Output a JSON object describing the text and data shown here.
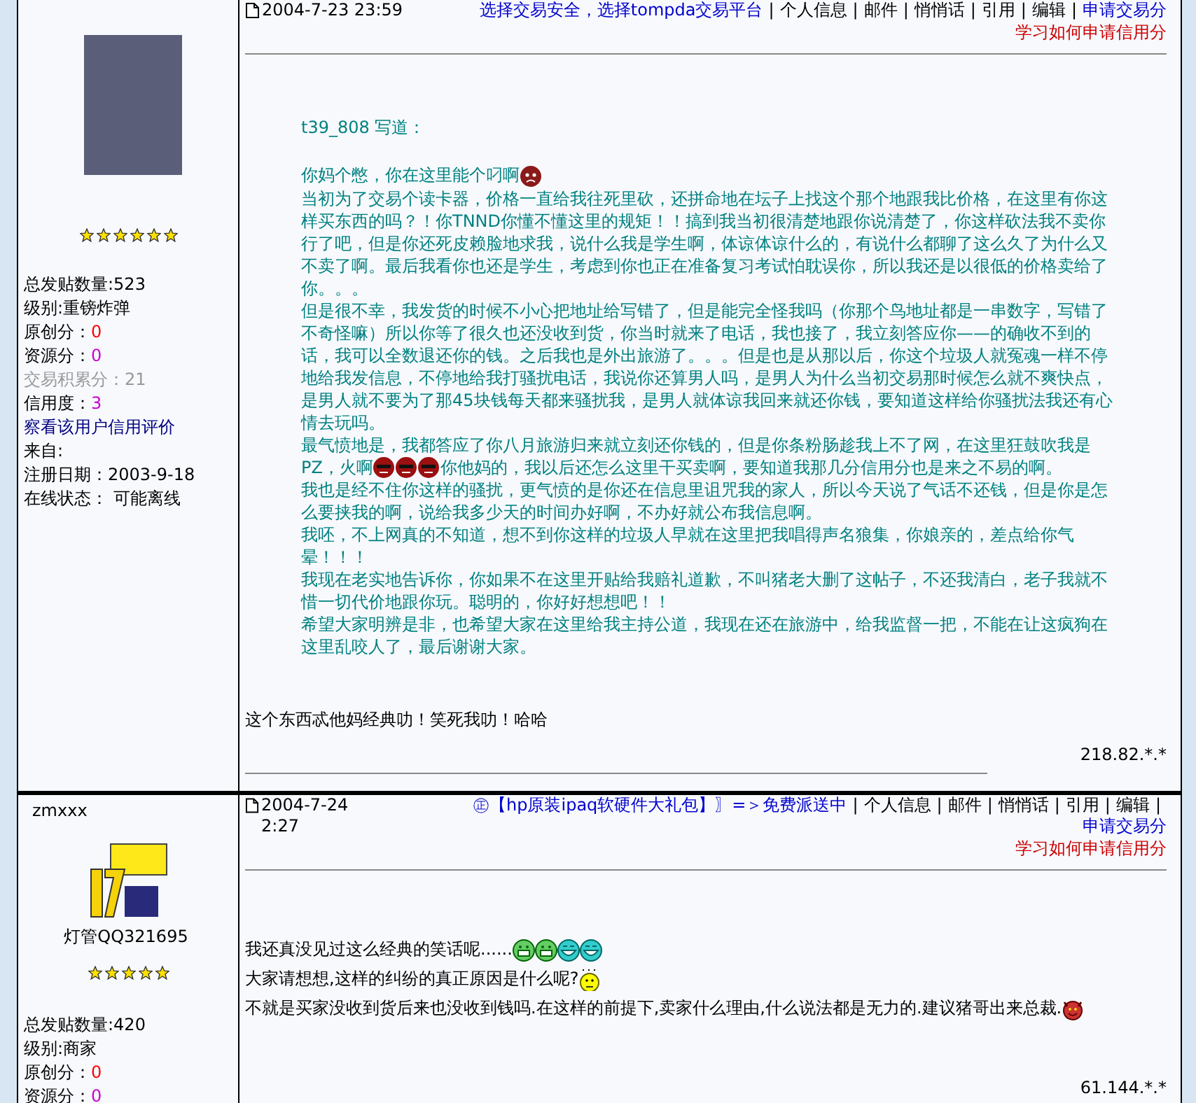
{
  "posts": [
    {
      "author": {
        "avatar": {
          "kind": "photo"
        },
        "stars": 6,
        "stats": [
          {
            "kind": "text",
            "label": "总发贴数量:523"
          },
          {
            "kind": "text",
            "label": "级别:重镑炸弹"
          },
          {
            "kind": "value",
            "label": "原创分：",
            "value": "0",
            "color": "#ff0000"
          },
          {
            "kind": "value",
            "label": "资源分：",
            "value": "0",
            "color": "#cc00cc"
          },
          {
            "kind": "dim",
            "label": "交易积累分：21"
          },
          {
            "kind": "value",
            "label": "信用度：",
            "value": "3",
            "color": "#cc00cc"
          },
          {
            "kind": "link",
            "label": "察看该用户信用评价"
          },
          {
            "kind": "text",
            "label": "来自:"
          },
          {
            "kind": "text",
            "label": "注册日期：2003-9-18"
          },
          {
            "kind": "text",
            "label": "在线状态： 可能离线"
          }
        ]
      },
      "date": "2004-7-23 23:59",
      "links": [
        {
          "kind": "promo",
          "text": "选择交易安全，选择tompda交易平台"
        },
        {
          "kind": "separator",
          "text": "|"
        },
        {
          "kind": "action",
          "text": "个人信息"
        },
        {
          "kind": "separator",
          "text": "|"
        },
        {
          "kind": "action",
          "text": "邮件"
        },
        {
          "kind": "separator",
          "text": "|"
        },
        {
          "kind": "action",
          "text": "悄悄话"
        },
        {
          "kind": "separator",
          "text": "|"
        },
        {
          "kind": "action",
          "text": "引用"
        },
        {
          "kind": "separator",
          "text": "|"
        },
        {
          "kind": "action",
          "text": "编辑"
        },
        {
          "kind": "separator",
          "text": "|"
        },
        {
          "kind": "apply",
          "text": "申请交易分"
        }
      ],
      "credit_link": "学习如何申请信用分",
      "quote": {
        "header": "t39_808 写道：",
        "paragraphs": [
          [
            {
              "kind": "text",
              "text": "你妈个憋，你在这里能个叼啊"
            },
            {
              "kind": "sad-face"
            }
          ],
          [
            {
              "kind": "text",
              "text": "当初为了交易个读卡器，价格一直给我往死里砍，还拼命地在坛子上找这个那个地跟我比价格，在这里有你这样买东西的吗？！你TNND你懂不懂这里的规矩！！搞到我当初很清楚地跟你说清楚了，你这样砍法我不卖你行了吧，但是你还死皮赖脸地求我，说什么我是学生啊，体谅体谅什么的，有说什么都聊了这么久了为什么又不卖了啊。最后我看你也还是学生，考虑到你也正在准备复习考试怕耽误你，所以我还是以很低的价格卖给了你。。。"
            }
          ],
          [
            {
              "kind": "text",
              "text": "但是很不幸，我发货的时候不小心把地址给写错了，但是能完全怪我吗（你那个鸟地址都是一串数字，写错了不奇怪嘛）所以你等了很久也还没收到货，你当时就来了电话，我也接了，我立刻答应你——的确收不到的话，我可以全数退还你的钱。之后我也是外出旅游了。。。但是也是从那以后，你这个垃圾人就冤魂一样不停地给我发信息，不停地给我打骚扰电话，我说你还算男人吗，是男人为什么当初交易那时候怎么就不爽快点，是男人就不要为了那45块钱每天都来骚扰我，是男人就体谅我回来就还你钱，要知道这样给你骚扰法我还有心情去玩吗。"
            }
          ],
          [
            {
              "kind": "text",
              "text": "最气愤地是，我都答应了你八月旅游归来就立刻还你钱的，但是你条粉肠趁我上不了网，在这里狂鼓吹我是"
            }
          ],
          [
            {
              "kind": "text",
              "text": "PZ，火啊"
            },
            {
              "kind": "sunglasses-face"
            },
            {
              "kind": "sunglasses-face"
            },
            {
              "kind": "sunglasses-face"
            },
            {
              "kind": "text",
              "text": "你他妈的，我以后还怎么这里干买卖啊，要知道我那几分信用分也是来之不易的啊。"
            }
          ],
          [
            {
              "kind": "text",
              "text": "我也是经不住你这样的骚扰，更气愤的是你还在信息里诅咒我的家人，所以今天说了气话不还钱，但是你是怎么要挟我的啊，说给我多少天的时间办好啊，不办好就公布我信息啊。"
            }
          ],
          [
            {
              "kind": "text",
              "text": "我呸，不上网真的不知道，想不到你这样的垃圾人早就在这里把我唱得声名狼集，你娘亲的，差点给你气晕！！！"
            }
          ],
          [
            {
              "kind": "text",
              "text": "我现在老实地告诉你，你如果不在这里开贴给我赔礼道歉，不叫猪老大删了这帖子，不还我清白，老子我就不惜一切代价地跟你玩。聪明的，你好好想想吧！！"
            }
          ],
          [
            {
              "kind": "text",
              "text": "希望大家明辨是非，也希望大家在这里给我主持公道，我现在还在旅游中，给我监督一把，不能在让这疯狗在这里乱咬人了，最后谢谢大家。"
            }
          ]
        ]
      },
      "reply": [
        [
          {
            "kind": "text",
            "text": "这个东西忒他妈经典叻！笑死我叻！哈哈"
          }
        ]
      ],
      "ip": "218.82.*.*",
      "signature_divider": true
    },
    {
      "author": {
        "name": "zmxxx",
        "avatar": {
          "kind": "logo"
        },
        "nickname": "灯管QQ321695",
        "stars": 5,
        "stats": [
          {
            "kind": "text",
            "label": "总发贴数量:420"
          },
          {
            "kind": "text",
            "label": "级别:商家"
          },
          {
            "kind": "value",
            "label": "原创分：",
            "value": "0",
            "color": "#ff0000"
          },
          {
            "kind": "value",
            "label": "资源分：",
            "value": "0",
            "color": "#cc00cc"
          }
        ]
      },
      "date": "2004-7-24 2:27",
      "links": [
        {
          "kind": "promo",
          "text": "㊣【hp原装ipaq软硬件大礼包】〗=＞免费派送中"
        },
        {
          "kind": "separator",
          "text": "|"
        },
        {
          "kind": "action",
          "text": "个人信息"
        },
        {
          "kind": "separator",
          "text": "|"
        },
        {
          "kind": "action",
          "text": "邮件"
        },
        {
          "kind": "separator",
          "text": "|"
        },
        {
          "kind": "action",
          "text": "悄悄话"
        },
        {
          "kind": "separator",
          "text": "|"
        },
        {
          "kind": "action",
          "text": "引用"
        },
        {
          "kind": "separator",
          "text": "|"
        },
        {
          "kind": "action",
          "text": "编辑"
        },
        {
          "kind": "separator",
          "text": "|"
        },
        {
          "kind": "apply",
          "text": "申请交易分"
        }
      ],
      "credit_link": "学习如何申请信用分",
      "reply": [
        [
          {
            "kind": "text",
            "text": "我还真没见过这么经典的笑话呢......"
          },
          {
            "kind": "grinning-face"
          },
          {
            "kind": "grinning-face"
          },
          {
            "kind": "laughing-face"
          },
          {
            "kind": "laughing-face"
          }
        ],
        [
          {
            "kind": "text",
            "text": "大家请想想,这样的纠纷的真正原因是什么呢?"
          },
          {
            "kind": "confused-face"
          }
        ],
        [
          {
            "kind": "text",
            "text": "不就是买家没收到货后来也没收到钱吗.在这样的前提下,卖家什么理由,什么说法都是无力的.建议猪哥出来总裁."
          },
          {
            "kind": "devil-face"
          }
        ]
      ],
      "ip": "61.144.*.*",
      "signature_divider": false
    }
  ]
}
